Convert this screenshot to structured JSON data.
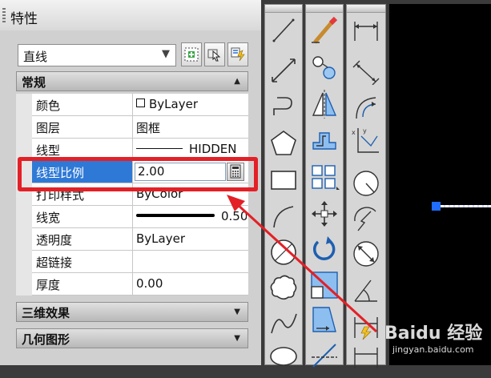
{
  "panel": {
    "title": "特性",
    "object_type_select": {
      "value": "直线"
    },
    "sections": {
      "general": {
        "label": "常规",
        "arrow": "▲"
      },
      "3d": {
        "label": "三维效果",
        "arrow": "▼"
      },
      "geometry": {
        "label": "几何图形",
        "arrow": "▼"
      }
    },
    "properties": [
      {
        "name": "颜色",
        "value": "ByLayer"
      },
      {
        "name": "图层",
        "value": "图框"
      },
      {
        "name": "线型",
        "value": "HIDDEN"
      },
      {
        "name": "线型比例",
        "value": "2.00"
      },
      {
        "name": "打印样式",
        "value": "ByColor"
      },
      {
        "name": "线宽",
        "value": "0.50 ..."
      },
      {
        "name": "透明度",
        "value": "ByLayer"
      },
      {
        "name": "超链接",
        "value": ""
      },
      {
        "name": "厚度",
        "value": "0.00"
      }
    ]
  },
  "watermark": {
    "brand": "Baidu 经验",
    "url": "jingyan.baidu.com"
  },
  "colors": {
    "selection_blue": "#2f79d6",
    "highlight_red": "#e32026",
    "grip_blue": "#1f6cff",
    "canvas_bg": "#000000"
  }
}
